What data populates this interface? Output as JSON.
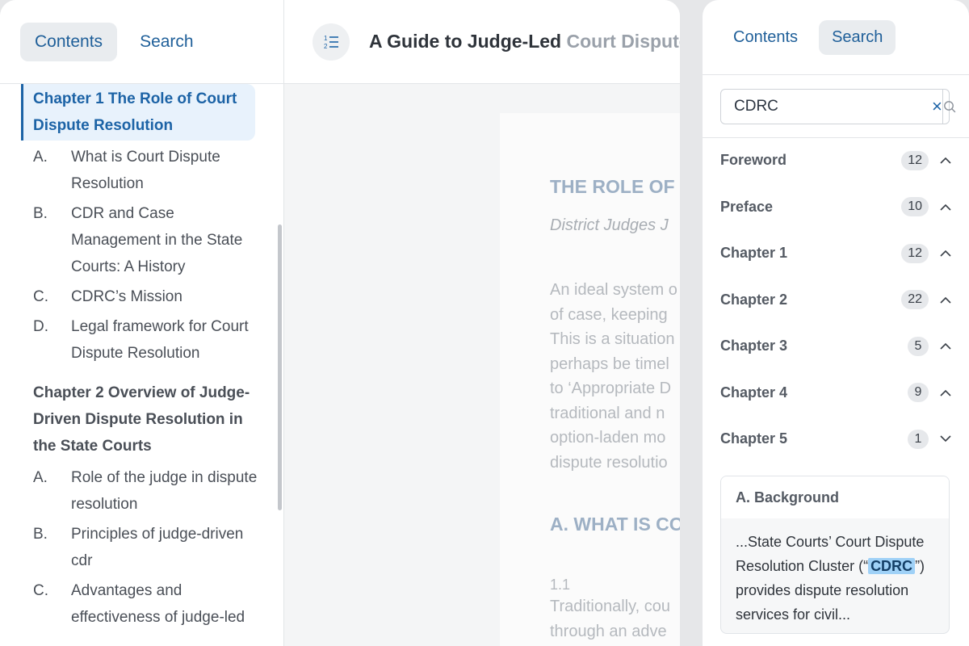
{
  "left_tabs": {
    "contents": "Contents",
    "search": "Search"
  },
  "toc": {
    "chapter1": {
      "title": "Chapter 1 The Role of Court Dispute Resolution",
      "items": [
        {
          "letter": "A.",
          "text": "What is Court Dispute Resolution"
        },
        {
          "letter": "B.",
          "text": "CDR and Case Management in the State Courts: A History"
        },
        {
          "letter": "C.",
          "text": "CDRC’s Mission"
        },
        {
          "letter": "D.",
          "text": "Legal framework for Court Dispute Resolution"
        }
      ]
    },
    "chapter2": {
      "title": "Chapter 2 Overview of Judge-Driven Dispute Resolution in the State Courts",
      "items": [
        {
          "letter": "A.",
          "text": "Role of the judge in dispute resolution"
        },
        {
          "letter": "B.",
          "text": "Principles of judge-driven cdr"
        },
        {
          "letter": "C.",
          "text": "Advantages and effectiveness of judge-led"
        }
      ]
    }
  },
  "document": {
    "title_main": "A Guide to Judge-Led",
    "title_faded": " Court Dispute R",
    "heading": "THE ROLE OF",
    "subtitle": "District Judges J",
    "paragraph_lines": [
      "An ideal system o",
      "of case, keeping",
      "This is a situation",
      "perhaps be timel",
      "to ‘Appropriate D",
      "traditional and n",
      "option-laden mo",
      "dispute resolutio"
    ],
    "section_heading": "A. WHAT IS COU",
    "section_number": "1.1",
    "section_lines": [
      "Traditionally, cou",
      "through  an  adve"
    ]
  },
  "right_tabs": {
    "contents": "Contents",
    "search": "Search"
  },
  "search": {
    "value": "CDRC",
    "clear_label": "×",
    "results": [
      {
        "name": "Foreword",
        "count": "12",
        "expanded": true
      },
      {
        "name": "Preface",
        "count": "10",
        "expanded": true
      },
      {
        "name": "Chapter 1",
        "count": "12",
        "expanded": true
      },
      {
        "name": "Chapter 2",
        "count": "22",
        "expanded": true
      },
      {
        "name": "Chapter 3",
        "count": "5",
        "expanded": true
      },
      {
        "name": "Chapter 4",
        "count": "9",
        "expanded": true
      },
      {
        "name": "Chapter 5",
        "count": "1",
        "expanded": false
      }
    ],
    "snippet": {
      "heading": "A. Background",
      "before": "...State Courts’ Court Dispute Resolution Cluster (“",
      "match": "CDRC",
      "after": "”) provides dispute resolution services for civil..."
    }
  },
  "icons": {
    "toc_button": "ordered-list-icon",
    "search": "magnifier-icon",
    "clear": "close-icon",
    "expanded": "chevron-up-icon",
    "collapsed": "chevron-down-icon"
  },
  "colors": {
    "accent": "#1c63a6",
    "active_bg": "#e8f2fc",
    "highlight": "#9fd1f7",
    "badge_bg": "#e6e8eb"
  }
}
